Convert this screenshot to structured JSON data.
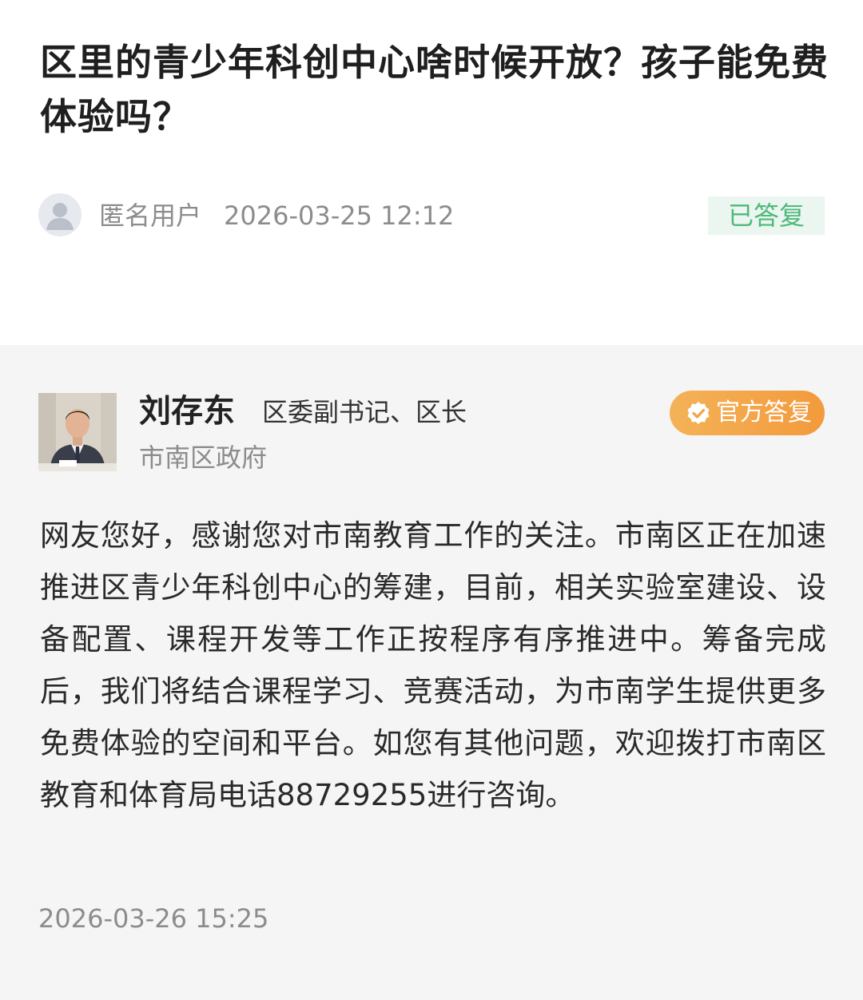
{
  "question": {
    "title": "区里的青少年科创中心啥时候开放？孩子能免费体验吗？",
    "asker_name": "匿名用户",
    "asked_at": "2026-03-25 12:12",
    "status": "已答复"
  },
  "answer": {
    "official_name": "刘存东",
    "official_title": "区委副书记、区长",
    "official_org": "市南区政府",
    "badge_label": "官方答复",
    "body": "网友您好，感谢您对市南教育工作的关注。市南区正在加速推进区青少年科创中心的筹建，目前，相关实验室建设、设备配置、课程开发等工作正按程序有序推进中。筹备完成后，我们将结合课程学习、竞赛活动，为市南学生提供更多免费体验的空间和平台。如您有其他问题，欢迎拨打市南区教育和体育局电话88729255进行咨询。",
    "answered_at": "2026-03-26 15:25"
  },
  "colors": {
    "status_green": "#4fb97b",
    "status_bg": "#eaf6ef",
    "badge_orange": "#f39a3c",
    "answer_bg": "#f5f5f5",
    "meta_gray": "#8c8c8c"
  },
  "icons": {
    "anonymous_avatar": "user-silhouette-icon",
    "official_badge": "verified-check-icon"
  }
}
